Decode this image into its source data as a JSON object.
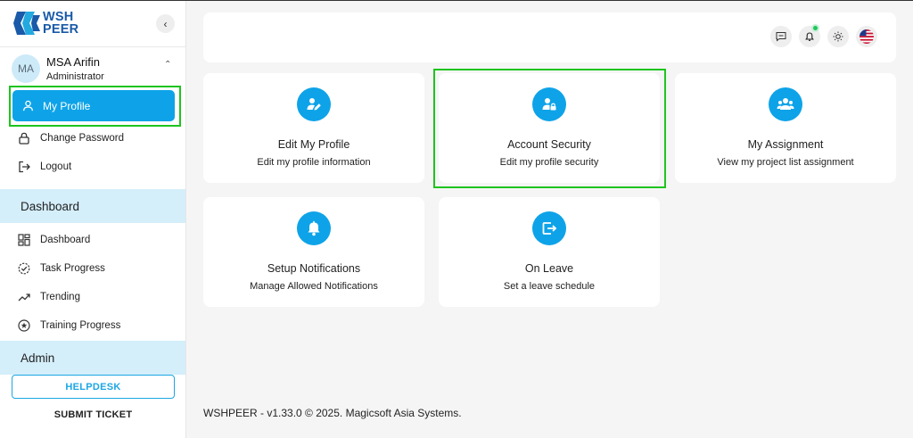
{
  "sidebar": {
    "brand": {
      "line1": "WSH",
      "line2": "PEER"
    },
    "collapse_icon": "chevron-left-icon",
    "user": {
      "initials": "MA",
      "name": "MSA Arifin",
      "role": "Administrator"
    },
    "profile_menu": [
      {
        "label": "My Profile",
        "icon": "user-icon",
        "active": true
      },
      {
        "label": "Change Password",
        "icon": "lock-icon"
      },
      {
        "label": "Logout",
        "icon": "logout-icon"
      }
    ],
    "sections": [
      {
        "title": "Dashboard",
        "items": [
          {
            "label": "Dashboard",
            "icon": "grid-icon"
          },
          {
            "label": "Task Progress",
            "icon": "circle-check-icon"
          },
          {
            "label": "Trending",
            "icon": "trending-icon"
          },
          {
            "label": "Training Progress",
            "icon": "star-circle-icon"
          }
        ]
      },
      {
        "title": "Admin",
        "items": []
      }
    ],
    "helpdesk_label": "HELPDESK",
    "submit_ticket_label": "SUBMIT TICKET"
  },
  "header": {
    "icons": [
      "message-icon",
      "bell-icon",
      "sun-icon",
      "us-flag-icon"
    ]
  },
  "cards": [
    {
      "title": "Edit My Profile",
      "subtitle": "Edit my profile information",
      "icon": "user-edit-icon"
    },
    {
      "title": "Account Security",
      "subtitle": "Edit my profile security",
      "icon": "user-lock-icon"
    },
    {
      "title": "My Assignment",
      "subtitle": "View my project list assignment",
      "icon": "user-group-icon"
    },
    {
      "title": "Setup Notifications",
      "subtitle": "Manage Allowed Notifications",
      "icon": "bell-icon"
    },
    {
      "title": "On Leave",
      "subtitle": "Set a leave schedule",
      "icon": "exit-icon"
    }
  ],
  "footer": {
    "text": "WSHPEER - v1.33.0 © 2025. Magicsoft Asia Systems."
  },
  "colors": {
    "accent": "#0ea3e8",
    "highlight": "#1ec41e",
    "section_bg": "#d4eefa"
  }
}
